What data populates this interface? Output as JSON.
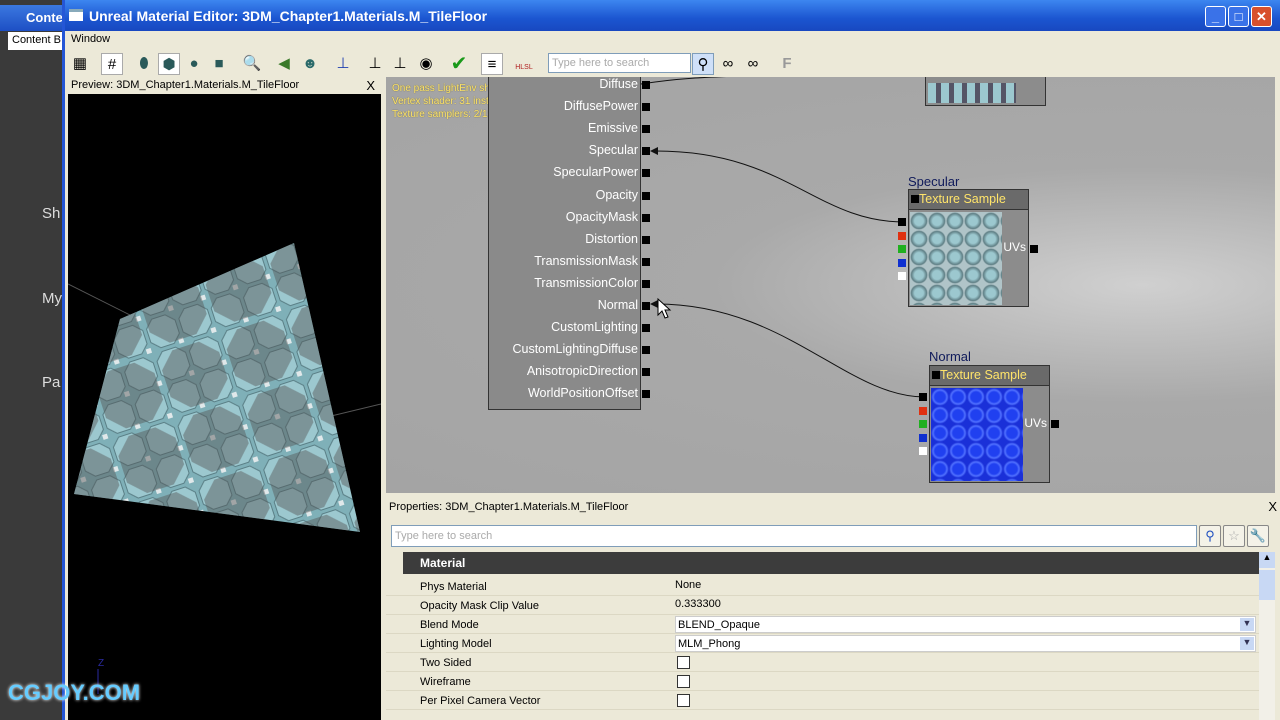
{
  "background_window": {
    "title": "Conte",
    "tab": "Content B",
    "labels": [
      "Sh",
      "My",
      "Pa"
    ]
  },
  "window": {
    "title": "Unreal Material Editor: 3DM_Chapter1.Materials.M_TileFloor",
    "menu": [
      "Window"
    ]
  },
  "toolbar": {
    "search_placeholder": "Type here to search",
    "hlsl_label": "HLSL"
  },
  "preview": {
    "title": "Preview: 3DM_Chapter1.Materials.M_TileFloor",
    "close": "X",
    "axis_label": "Z"
  },
  "graph": {
    "stats": [
      "One pass LightEnv shader: 41 instructions",
      "Vertex shader: 31 instructions",
      "Texture samplers: 2/15"
    ],
    "material_inputs": [
      "Diffuse",
      "DiffusePower",
      "Emissive",
      "Specular",
      "SpecularPower",
      "Opacity",
      "OpacityMask",
      "Distortion",
      "TransmissionMask",
      "TransmissionColor",
      "Normal",
      "CustomLighting",
      "CustomLightingDiffuse",
      "AnisotropicDirection",
      "WorldPositionOffset"
    ],
    "nodes": [
      {
        "label": "Specular",
        "title": "Texture Sample",
        "input": "UVs"
      },
      {
        "label": "Normal",
        "title": "Texture Sample",
        "input": "UVs"
      }
    ],
    "pin_colors": [
      "#000000",
      "#e03010",
      "#20b020",
      "#1030d0",
      "#ffffff"
    ]
  },
  "properties": {
    "title": "Properties: 3DM_Chapter1.Materials.M_TileFloor",
    "close": "X",
    "search_placeholder": "Type here to search",
    "category": "Material",
    "rows": [
      {
        "name": "Phys Material",
        "value": "None"
      },
      {
        "name": "Opacity Mask Clip Value",
        "value": "0.333300"
      },
      {
        "name": "Blend Mode",
        "value": "BLEND_Opaque"
      },
      {
        "name": "Lighting Model",
        "value": "MLM_Phong"
      },
      {
        "name": "Two Sided",
        "checked": false
      },
      {
        "name": "Wireframe",
        "checked": false
      },
      {
        "name": "Per Pixel Camera Vector",
        "checked": false
      }
    ]
  },
  "watermark": "CGJOY.COM"
}
